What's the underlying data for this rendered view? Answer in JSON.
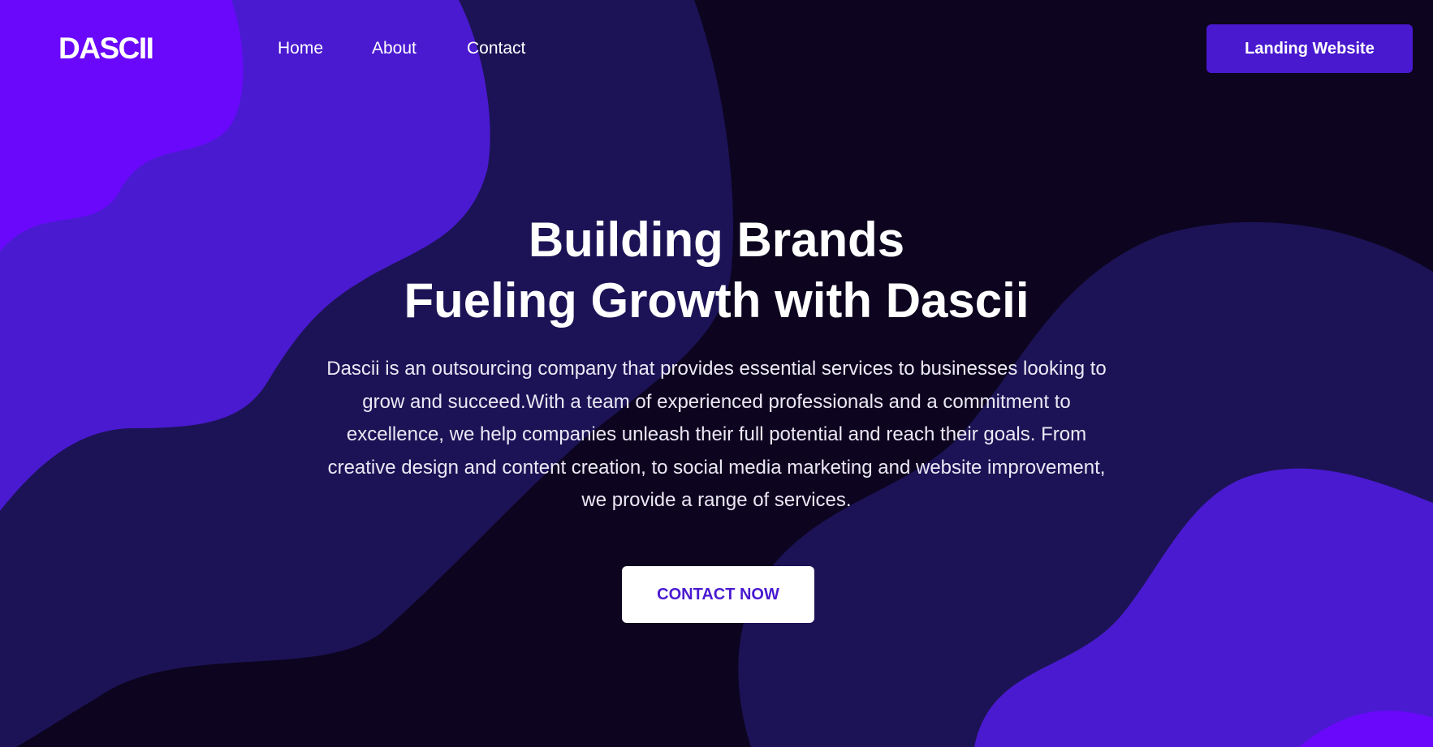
{
  "brand": {
    "logo_text": "DASCII"
  },
  "nav": {
    "items": [
      {
        "label": "Home"
      },
      {
        "label": "About"
      },
      {
        "label": "Contact"
      }
    ],
    "landing_button_label": "Landing Website"
  },
  "hero": {
    "title_line1": "Building Brands",
    "title_line2": "Fueling Growth with Dascii",
    "description": "Dascii is an outsourcing company that provides essential services to businesses looking to grow and succeed.With a team of experienced professionals and a commitment to excellence, we help companies unleash their full potential and reach their goals. From creative design and content creation, to social media marketing and website improvement, we provide a range of services.",
    "cta_label": "CONTACT NOW"
  },
  "colors": {
    "background": "#0d041f",
    "blob_bright": "#6a08fc",
    "blob_mid": "#4a1ad0",
    "blob_dark": "#1c1356",
    "accent_button": "#4819cf",
    "cta_text": "#4a1ad0"
  }
}
